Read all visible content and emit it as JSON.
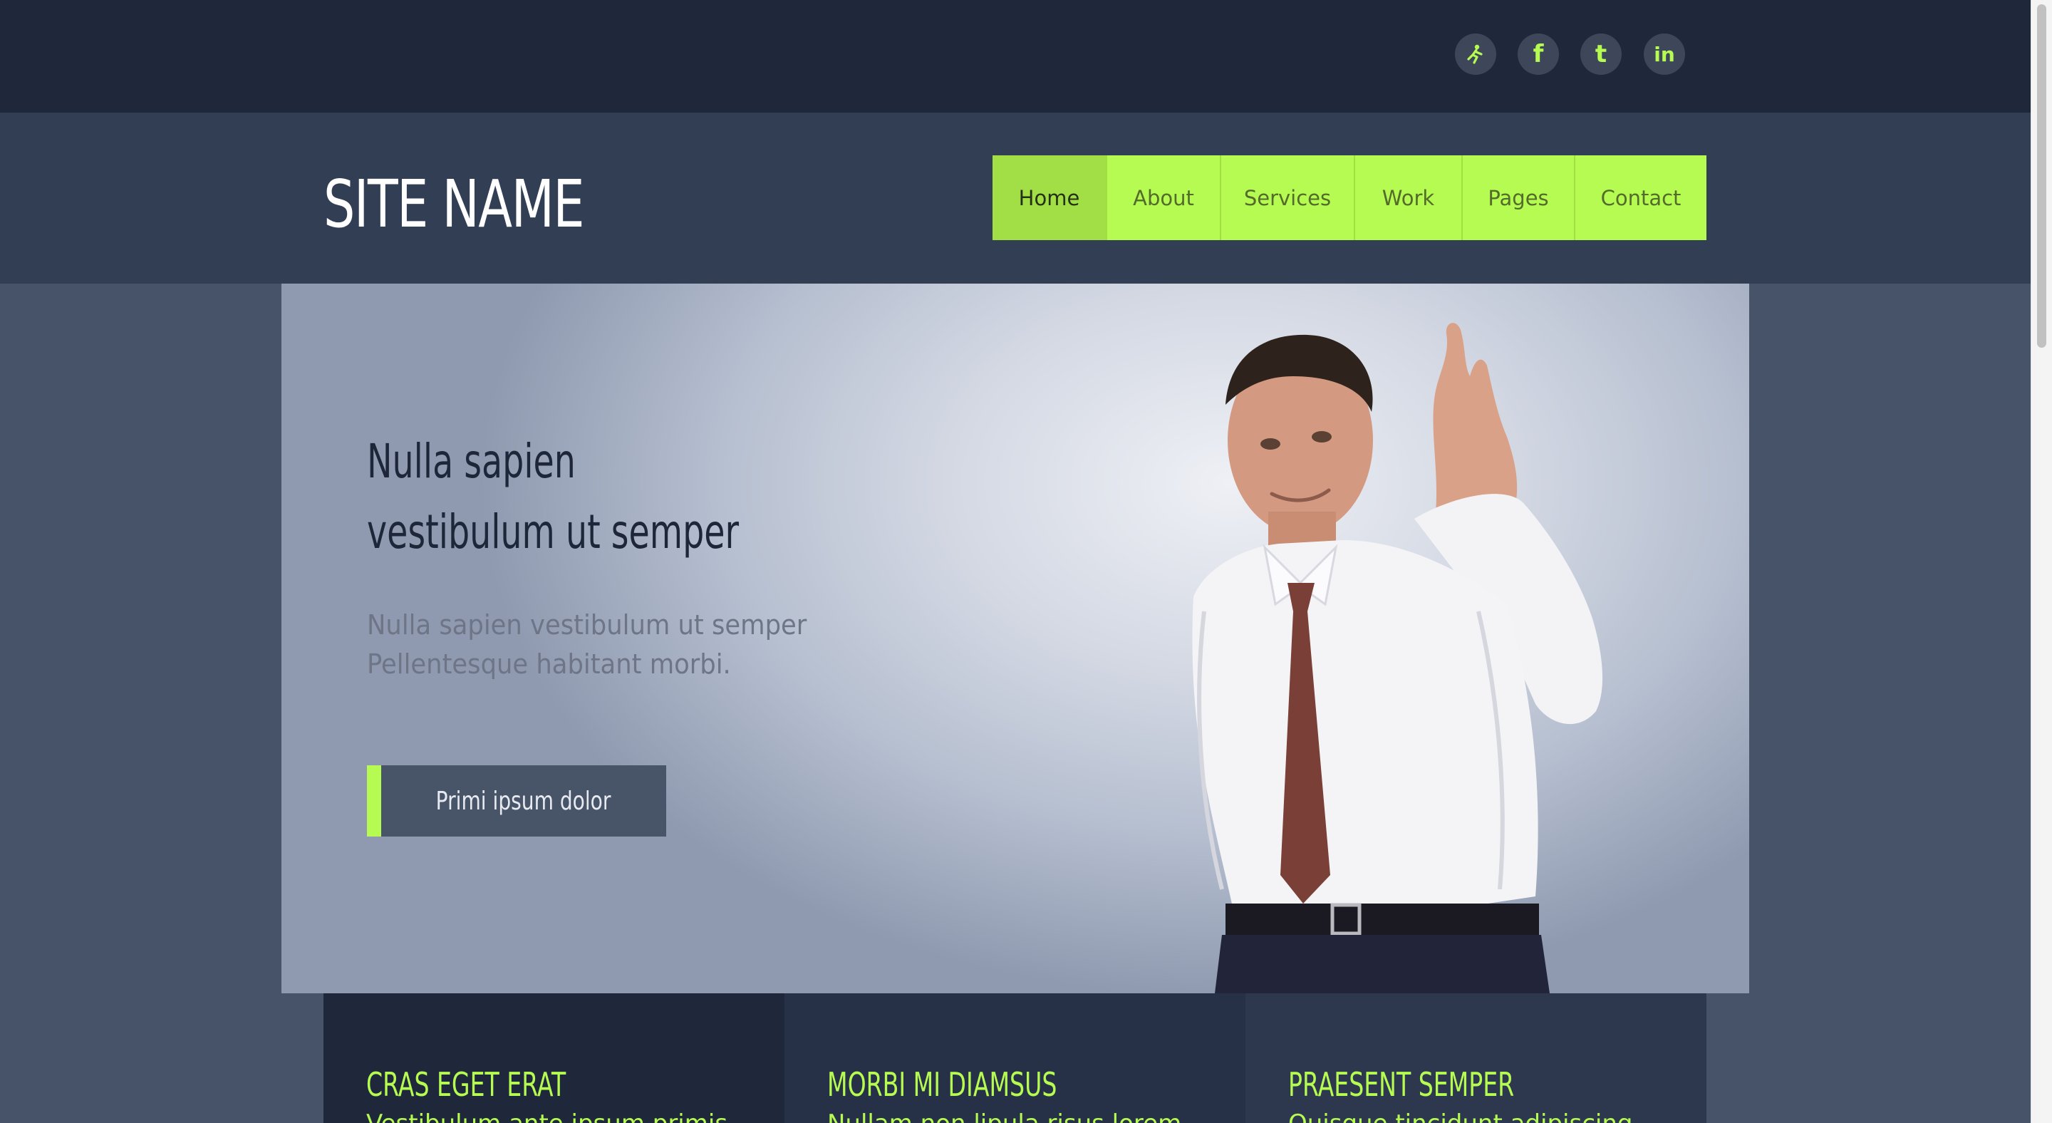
{
  "social": {
    "icons": [
      "stumbleupon-icon",
      "facebook-icon",
      "twitter-icon",
      "linkedin-icon"
    ],
    "facebook_glyph": "f",
    "twitter_glyph": "t",
    "linkedin_glyph": "in"
  },
  "header": {
    "site_name": "SITE NAME"
  },
  "nav": {
    "items": [
      {
        "label": "Home",
        "active": true
      },
      {
        "label": "About",
        "active": false
      },
      {
        "label": "Services",
        "active": false
      },
      {
        "label": "Work",
        "active": false
      },
      {
        "label": "Pages",
        "active": false
      },
      {
        "label": "Contact",
        "active": false
      }
    ]
  },
  "hero": {
    "title_line1": "Nulla sapien",
    "title_line2": "vestibulum ut semper",
    "subtitle_line1": "Nulla sapien vestibulum ut semper",
    "subtitle_line2": "Pellentesque habitant morbi.",
    "cta_label": "Primi ipsum dolor"
  },
  "features": [
    {
      "title": "CRAS EGET ERAT",
      "text": "Vestibulum ante ipsum primis"
    },
    {
      "title": "MORBI MI DIAMSUS",
      "text": "Nullam non lipula risus lorem"
    },
    {
      "title": "PRAESENT SEMPER",
      "text": "Quisque tincidunt adipiscing"
    }
  ],
  "colors": {
    "accent": "#b6fb51",
    "topbar": "#1f283b",
    "header": "#323e54",
    "page": "#475369"
  }
}
